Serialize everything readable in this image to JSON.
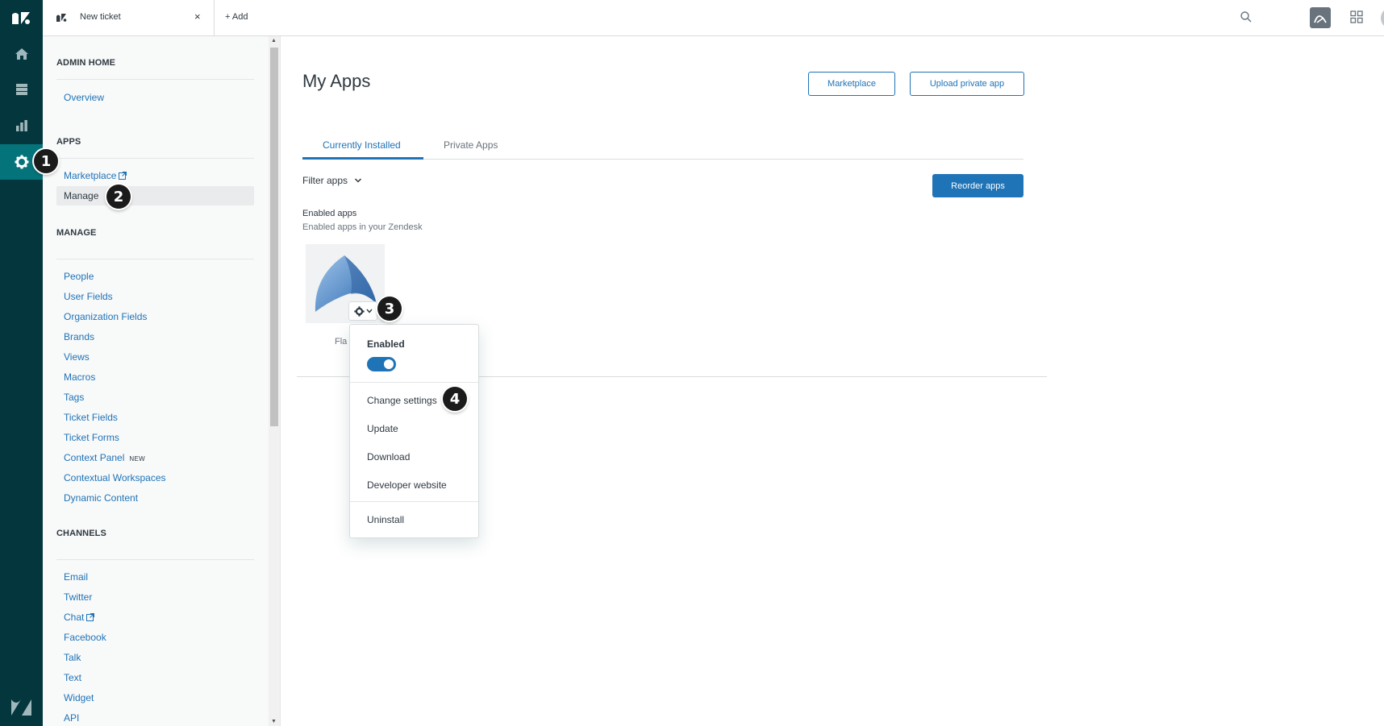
{
  "topbar": {
    "ticket_tab_label": "New ticket",
    "close_glyph": "×",
    "add_label": "+ Add"
  },
  "sidebar": {
    "admin_home": {
      "heading": "ADMIN HOME",
      "items": [
        "Overview"
      ]
    },
    "apps": {
      "heading": "APPS",
      "items": [
        "Marketplace",
        "Manage"
      ],
      "active": "Manage"
    },
    "manage": {
      "heading": "MANAGE",
      "items": [
        "People",
        "User Fields",
        "Organization Fields",
        "Brands",
        "Views",
        "Macros",
        "Tags",
        "Ticket Fields",
        "Ticket Forms",
        "Context Panel",
        "Contextual Workspaces",
        "Dynamic Content"
      ],
      "new_tag": "NEW"
    },
    "channels": {
      "heading": "CHANNELS",
      "items": [
        "Email",
        "Twitter",
        "Chat",
        "Facebook",
        "Talk",
        "Text",
        "Widget",
        "API"
      ]
    }
  },
  "main": {
    "title": "My Apps",
    "marketplace_button": "Marketplace",
    "upload_button": "Upload private app",
    "tabs": [
      {
        "label": "Currently Installed",
        "active": true
      },
      {
        "label": "Private Apps",
        "active": false
      }
    ],
    "filter_label": "Filter apps",
    "reorder_button": "Reorder apps",
    "enabled_title": "Enabled apps",
    "enabled_subtitle": "Enabled apps in your Zendesk",
    "app_name_visible": "Fla"
  },
  "menu": {
    "heading": "Enabled",
    "toggle_on": true,
    "items": [
      "Change settings",
      "Update",
      "Download",
      "Developer website"
    ],
    "danger_item": "Uninstall"
  },
  "badges": [
    "1",
    "2",
    "3",
    "4"
  ],
  "colors": {
    "rail": "#03363d",
    "rail_active": "#05747a",
    "link": "#1f73b7",
    "primary": "#1f73b7"
  }
}
